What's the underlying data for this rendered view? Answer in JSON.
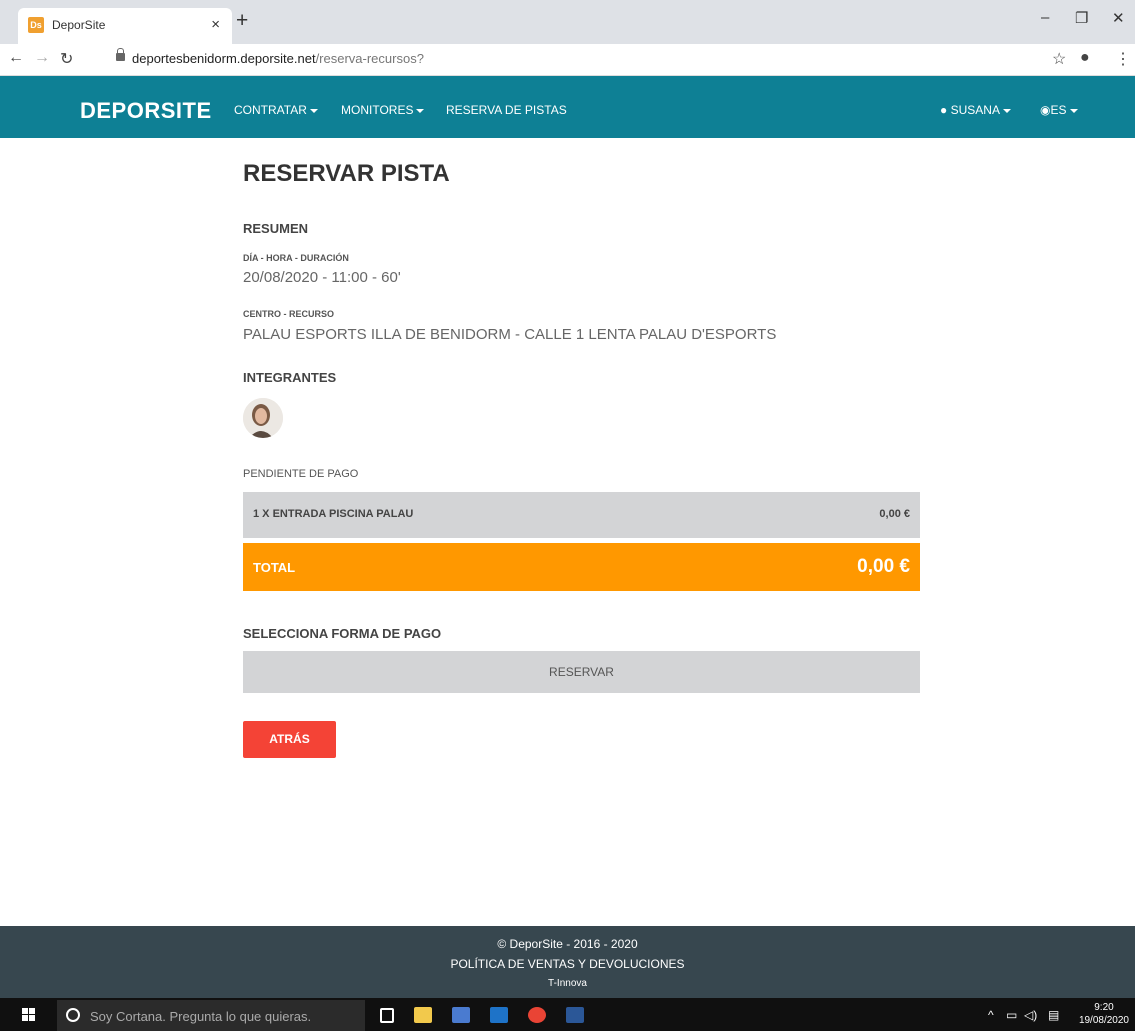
{
  "browser": {
    "tab_title": "DeporSite",
    "tab_favicon_text": "Ds",
    "url_host": "deportesbenidorm.deporsite.net",
    "url_path": "/reserva-recursos?"
  },
  "navbar": {
    "brand": "DEPORSITE",
    "items": [
      {
        "label": "CONTRATAR",
        "dropdown": true
      },
      {
        "label": "MONITORES",
        "dropdown": true
      },
      {
        "label": "RESERVA DE PISTAS",
        "dropdown": false
      }
    ],
    "user": "SUSANA",
    "language": "ES"
  },
  "page": {
    "title": "RESERVAR PISTA",
    "resumen_heading": "RESUMEN",
    "date_label": "DÍA - HORA - DURACIÓN",
    "date_value": "20/08/2020 - 11:00 - 60'",
    "center_label": "CENTRO - RECURSO",
    "center_value": "PALAU ESPORTS ILLA DE BENIDORM - CALLE 1 LENTA PALAU D'ESPORTS",
    "members_heading": "INTEGRANTES",
    "pending_label": "PENDIENTE DE PAGO",
    "line_item": {
      "label": "1 X ENTRADA PISCINA PALAU",
      "amount": "0,00 €"
    },
    "total": {
      "label": "TOTAL",
      "amount": "0,00 €"
    },
    "payment_heading": "SELECCIONA FORMA DE PAGO",
    "reservar_label": "RESERVAR",
    "atras_label": "ATRÁS"
  },
  "footer": {
    "copyright": "© DeporSite - 2016 - 2020",
    "policy_link": "POLÍTICA DE VENTAS Y DEVOLUCIONES",
    "company": "T-Innova"
  },
  "taskbar": {
    "search_placeholder": "Soy Cortana. Pregunta lo que quieras.",
    "time": "9:20",
    "date": "19/08/2020"
  },
  "colors": {
    "navbar": "#0e8095",
    "total_bar": "#ff9800",
    "back_button": "#f44336",
    "footer": "#37474f"
  }
}
